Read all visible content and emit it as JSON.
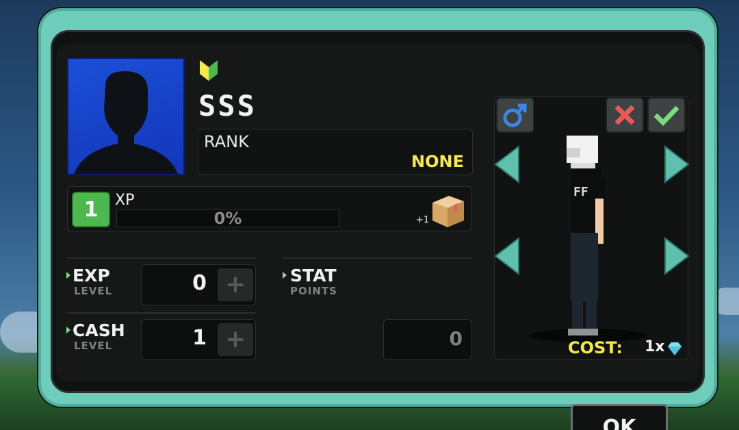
{
  "player": {
    "name": "SSS",
    "rank_label": "RANK",
    "rank_value": "NONE",
    "level": "1",
    "xp_label": "XP",
    "xp_percent_text": "0%",
    "xp_progress": 0,
    "reward_bonus": "+1"
  },
  "stats": {
    "exp": {
      "label": "EXP",
      "sub": "LEVEL",
      "value": "0"
    },
    "cash": {
      "label": "CASH",
      "sub": "LEVEL",
      "value": "1"
    },
    "stat_points": {
      "label": "STAT",
      "sub": "POINTS",
      "value": "0"
    }
  },
  "character": {
    "cost_label": "COST:",
    "cost_value": "1x",
    "shirt_print": "FF"
  },
  "buttons": {
    "ok_label": "OK"
  },
  "colors": {
    "frame": "#6fcdbb",
    "accent_yellow": "#f7e94a",
    "level_green": "#4db84d",
    "cancel_red": "#e85a5a",
    "confirm_green": "#7ddc7d",
    "gender_blue": "#3d86e6"
  },
  "icons": {
    "badge": "beginner-chevron-icon",
    "gender": "male-symbol-icon",
    "cancel": "red-x-icon",
    "confirm": "green-check-icon",
    "crate": "crate-icon",
    "gem": "diamond-icon"
  }
}
